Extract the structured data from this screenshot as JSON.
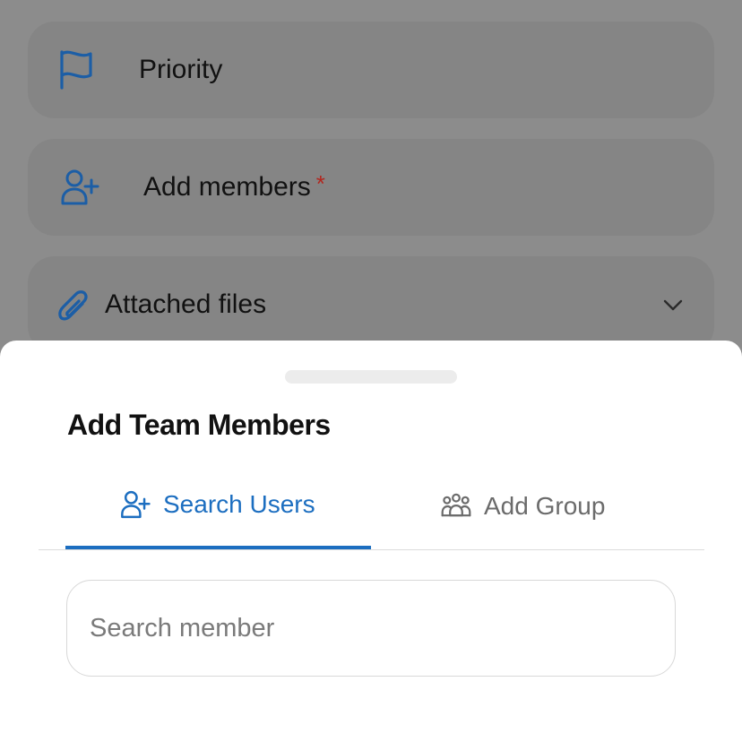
{
  "form": {
    "priority_label": "Priority",
    "add_members_label": "Add members",
    "required_marker": "*",
    "attached_files_label": "Attached files"
  },
  "sheet": {
    "title": "Add Team Members",
    "tabs": [
      {
        "label": "Search Users",
        "icon": "add-user-icon",
        "active": true
      },
      {
        "label": "Add Group",
        "icon": "group-icon",
        "active": false
      }
    ],
    "search": {
      "placeholder": "Search member",
      "value": ""
    }
  },
  "colors": {
    "accent": "#1c6ec0",
    "overlay_bg": "#8c8c8c",
    "required": "#b3261e",
    "inactive_tab": "#6b6b6b"
  }
}
